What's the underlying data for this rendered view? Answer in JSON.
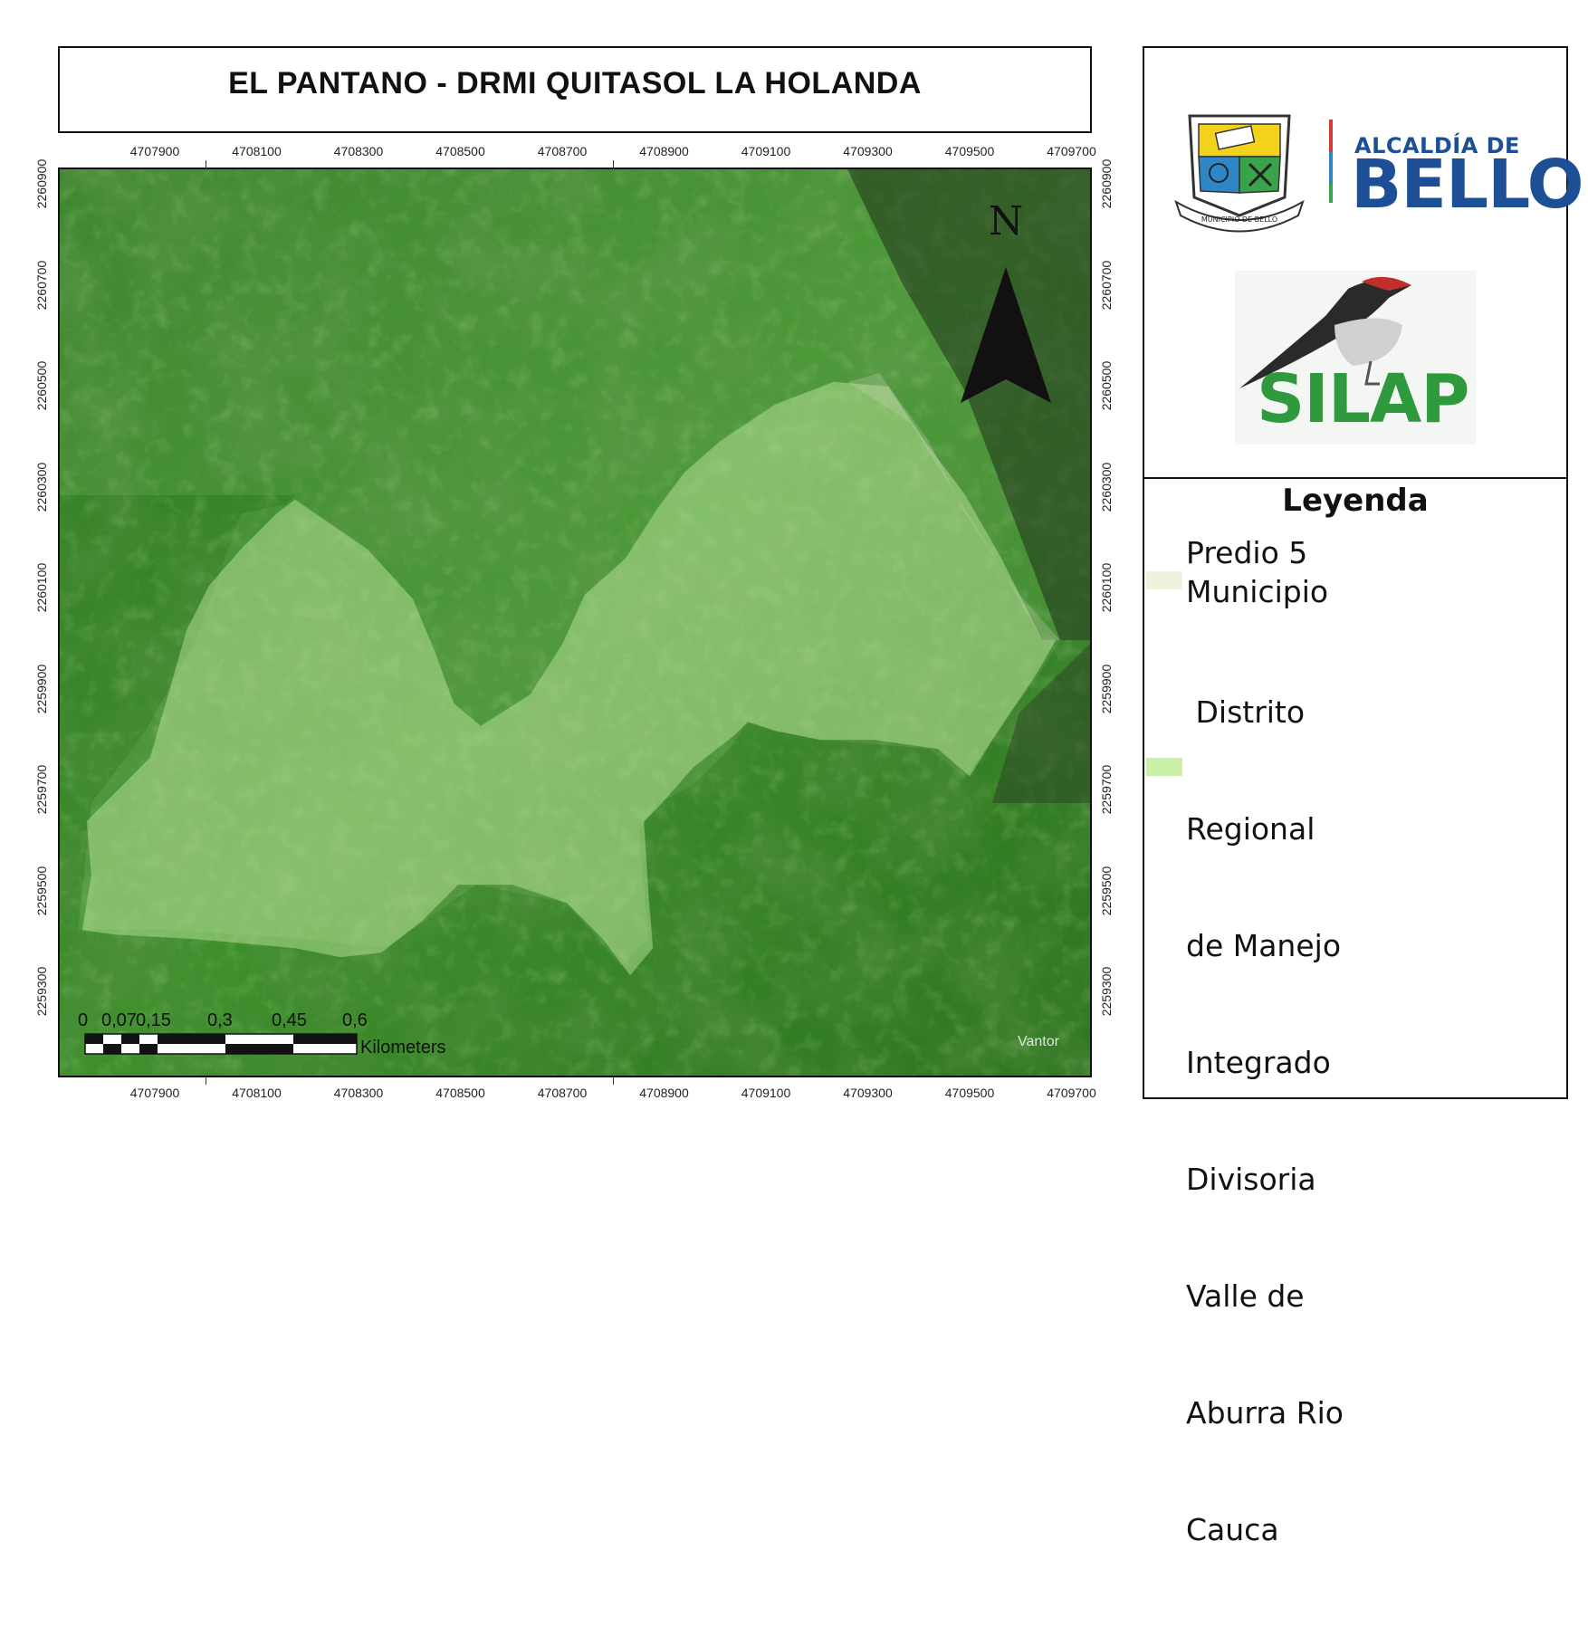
{
  "title": "EL PANTANO - DRMI QUITASOL LA HOLANDA",
  "x_ticks": [
    "4707900",
    "4708100",
    "4708300",
    "4708500",
    "4708700",
    "4708900",
    "4709100",
    "4709300",
    "4709500",
    "4709700"
  ],
  "y_ticks": [
    "2260900",
    "2260700",
    "2260500",
    "2260300",
    "2260100",
    "2259900",
    "2259700",
    "2259500",
    "2259300"
  ],
  "north_label": "N",
  "scale_bar": {
    "labels": [
      "0",
      "0,07",
      "0,15",
      "0,3",
      "0,45",
      "0,6"
    ],
    "unit": "Kilometers"
  },
  "imagery_credit": "Vantor",
  "logos": {
    "alcaldia_top": "ALCALDÍA DE",
    "alcaldia_main": "BELLO",
    "seal_text": "MUNICIPIO DE BELLO",
    "silap": "SILAP"
  },
  "legend": {
    "title": "Leyenda",
    "items": [
      {
        "label_lines": [
          "Predio 5",
          "Municipio"
        ],
        "color": "#eef3dc"
      },
      {
        "label_lines": [
          " Distrito",
          "Regional",
          "de Manejo",
          "Integrado",
          "Divisoria",
          "Valle de",
          "Aburra Rio",
          "Cauca"
        ],
        "color": "#c8f0a8"
      }
    ]
  },
  "colors": {
    "map_green": "#3e8a2c",
    "polygon_fill": "#b9e09c",
    "alcaldia_blue": "#1c4f96",
    "silap_green": "#2f9a3d"
  }
}
